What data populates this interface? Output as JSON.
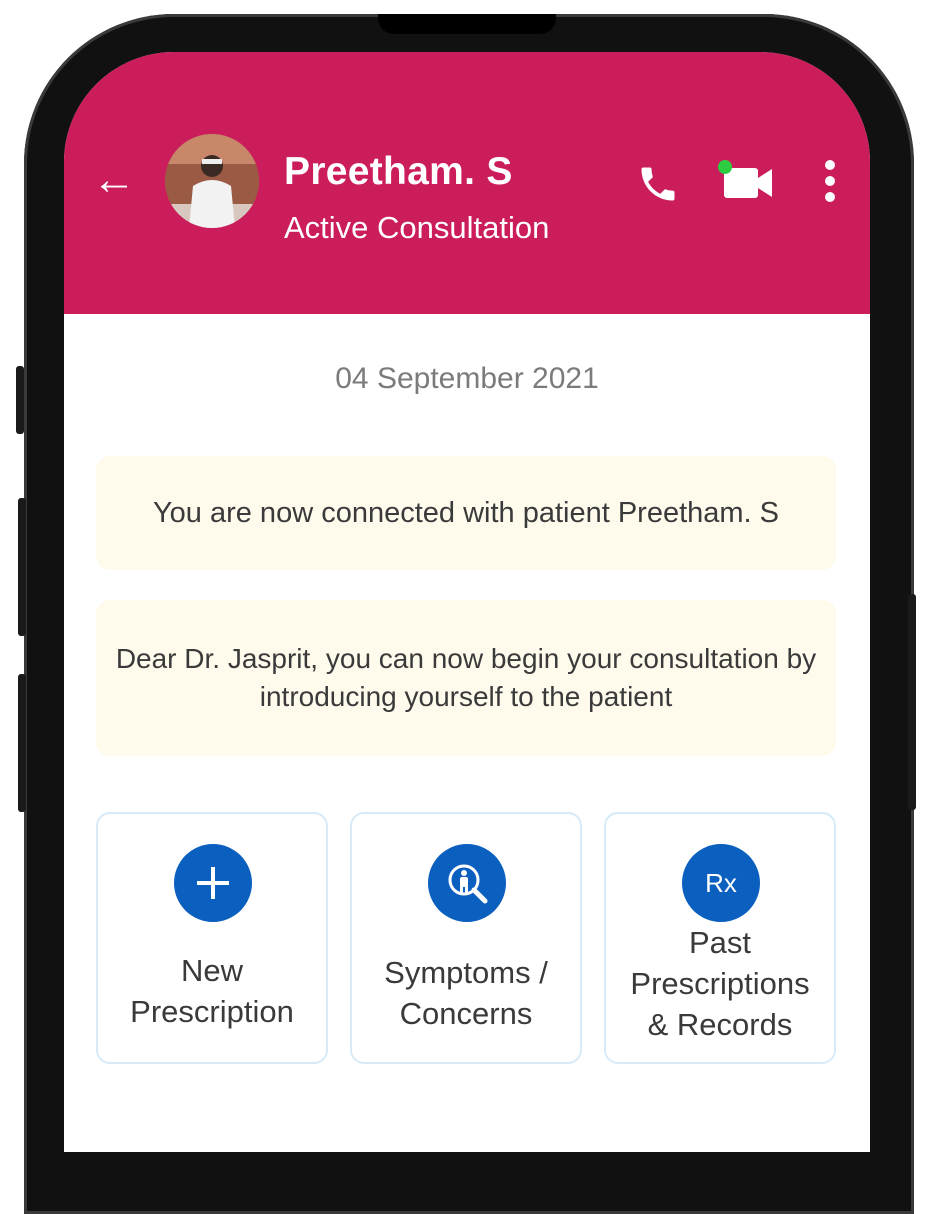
{
  "header": {
    "patient_name": "Preetham. S",
    "status": "Active Consultation",
    "back_icon": "back-arrow-icon",
    "call_icon": "phone-icon",
    "video_icon": "video-call-icon",
    "menu_icon": "more-vertical-icon"
  },
  "chat": {
    "date": "04 September 2021",
    "system_messages": [
      "You are now connected with patient Preetham. S",
      "Dear Dr. Jasprit, you can now begin your consultation by introducing yourself to the patient"
    ]
  },
  "actions": [
    {
      "label_line1": "New",
      "label_line2": "Prescription",
      "icon": "plus-icon"
    },
    {
      "label_line1": "Symptoms /",
      "label_line2": "Concerns",
      "icon": "symptoms-search-icon"
    },
    {
      "label_line1": "Past",
      "label_line2": "Prescriptions",
      "label_line3": "& Records",
      "icon_text": "Rx"
    }
  ],
  "colors": {
    "header_bg": "#cb1c5b",
    "action_blue": "#0b5fbf",
    "message_bg": "#fefaec",
    "online_dot": "#2ecc40"
  }
}
